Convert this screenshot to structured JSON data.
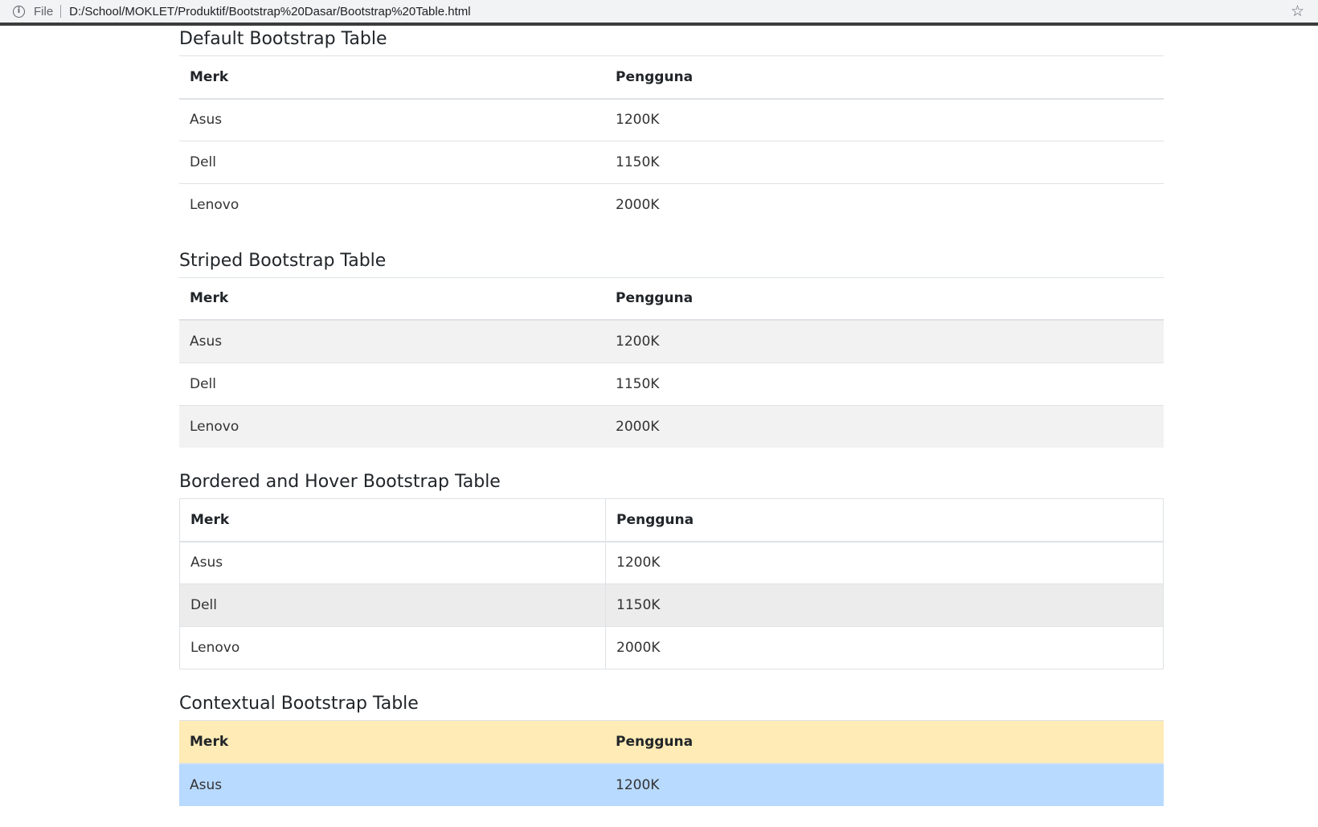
{
  "browser": {
    "file_label": "File",
    "url": "D:/School/MOKLET/Produktif/Bootstrap%20Dasar/Bootstrap%20Table.html"
  },
  "sections": [
    {
      "title": "Default Bootstrap Table",
      "headers": [
        "Merk",
        "Pengguna"
      ],
      "rows": [
        [
          "Asus",
          "1200K"
        ],
        [
          "Dell",
          "1150K"
        ],
        [
          "Lenovo",
          "2000K"
        ]
      ]
    },
    {
      "title": "Striped Bootstrap Table",
      "headers": [
        "Merk",
        "Pengguna"
      ],
      "rows": [
        [
          "Asus",
          "1200K"
        ],
        [
          "Dell",
          "1150K"
        ],
        [
          "Lenovo",
          "2000K"
        ]
      ]
    },
    {
      "title": "Bordered and Hover Bootstrap Table",
      "headers": [
        "Merk",
        "Pengguna"
      ],
      "rows": [
        [
          "Asus",
          "1200K"
        ],
        [
          "Dell",
          "1150K"
        ],
        [
          "Lenovo",
          "2000K"
        ]
      ]
    },
    {
      "title": "Contextual Bootstrap Table",
      "headers": [
        "Merk",
        "Pengguna"
      ],
      "rows": [
        [
          "Asus",
          "1200K"
        ]
      ]
    }
  ],
  "colors": {
    "striped_row": "#f2f2f2",
    "hover_row": "#ececec",
    "warning_header": "#ffebb6",
    "info_row": "#b8daff"
  }
}
